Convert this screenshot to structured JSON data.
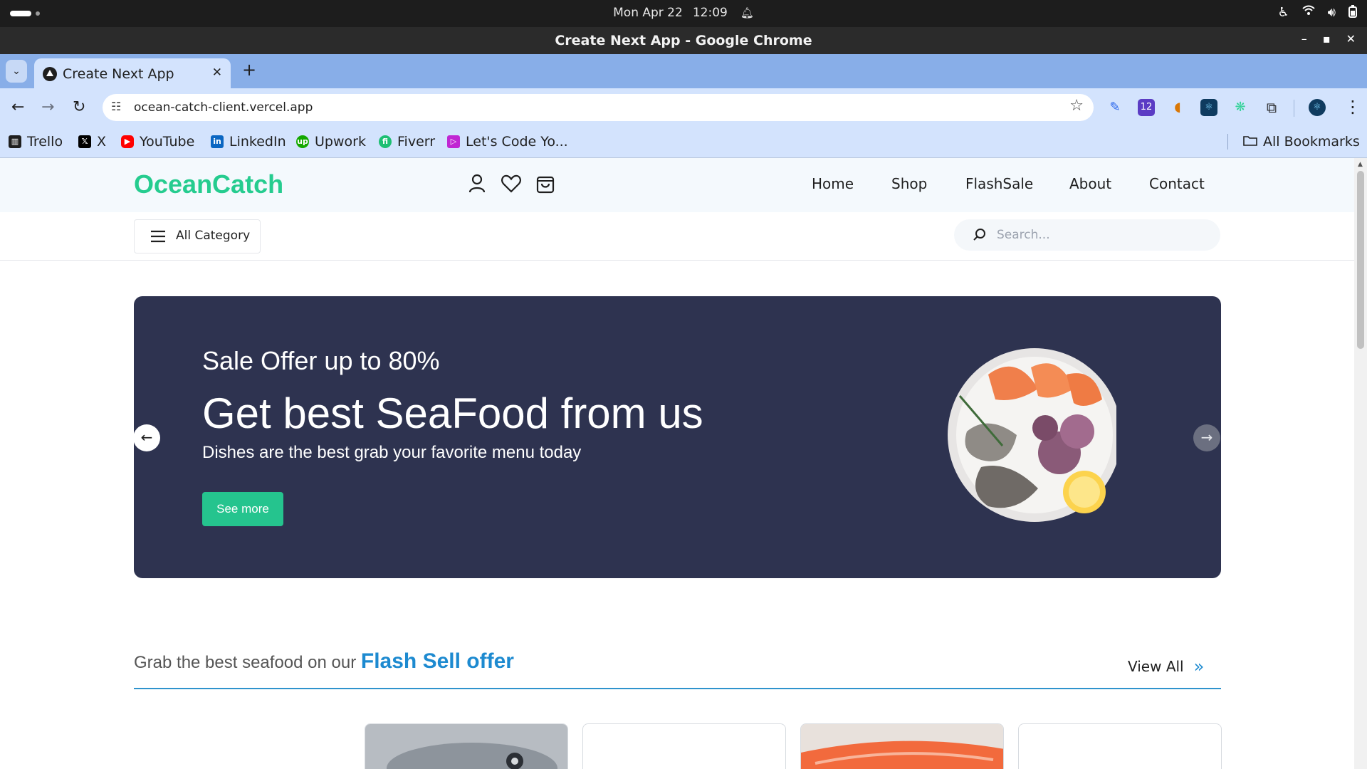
{
  "os": {
    "date": "Mon Apr 22",
    "time": "12:09"
  },
  "window": {
    "title": "Create Next App - Google Chrome"
  },
  "browser": {
    "tab_title": "Create Next App",
    "url": "ocean-catch-client.vercel.app",
    "extension_badge": "12",
    "bookmarks": [
      {
        "label": "Trello",
        "icon": "trello-icon",
        "color": "#1f1f1f"
      },
      {
        "label": "X",
        "icon": "x-icon",
        "color": "#000000"
      },
      {
        "label": "YouTube",
        "icon": "youtube-icon",
        "color": "#ff0000"
      },
      {
        "label": "LinkedIn",
        "icon": "linkedin-icon",
        "color": "#0a66c2"
      },
      {
        "label": "Upwork",
        "icon": "upwork-icon",
        "color": "#14a800"
      },
      {
        "label": "Fiverr",
        "icon": "fiverr-icon",
        "color": "#1dbf73"
      },
      {
        "label": "Let's Code Yo...",
        "icon": "letscode-icon",
        "color": "#c026d3"
      }
    ],
    "all_bookmarks": "All Bookmarks"
  },
  "site": {
    "logo": "OceanCatch",
    "nav": [
      "Home",
      "Shop",
      "FlashSale",
      "About",
      "Contact"
    ],
    "category_button": "All Category",
    "search_placeholder": "Search...",
    "hero": {
      "kicker": "Sale Offer up to 80%",
      "title": "Get best SeaFood from us",
      "subtitle": "Dishes are the best grab your favorite menu today",
      "button": "See more"
    },
    "flash": {
      "lead": "Grab the best seafood on our",
      "highlight": "Flash Sell offer",
      "view_all": "View All"
    }
  },
  "colors": {
    "brand": "#25cc8f",
    "hero_bg": "#2e3350",
    "accent_blue": "#1d8ad0",
    "button_green": "#25c48e"
  }
}
